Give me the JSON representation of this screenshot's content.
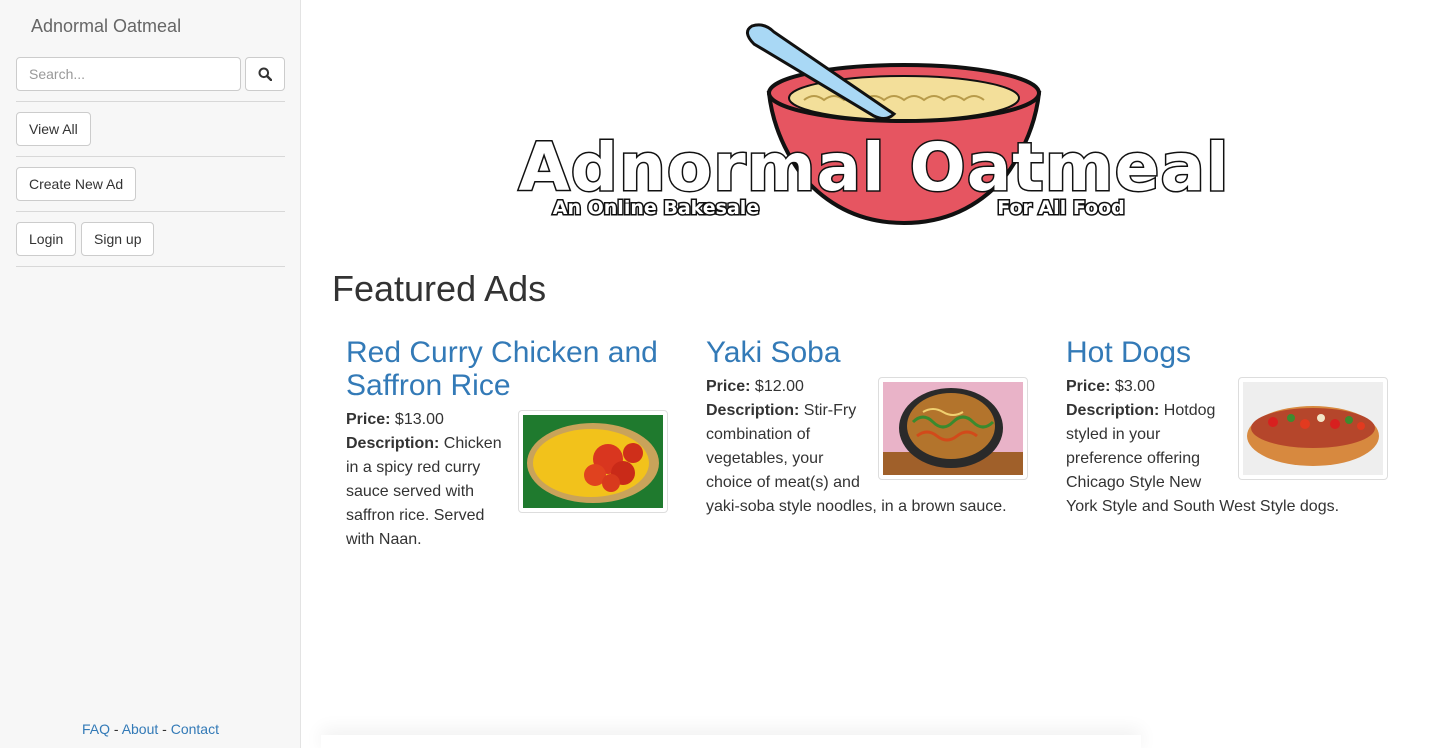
{
  "sidebar": {
    "brand": "Adnormal Oatmeal",
    "search_placeholder": "Search...",
    "view_all_label": "View All",
    "create_ad_label": "Create New Ad",
    "login_label": "Login",
    "signup_label": "Sign up",
    "footer": {
      "faq": "FAQ",
      "sep1": " - ",
      "about": "About",
      "sep2": " - ",
      "contact": "Contact"
    }
  },
  "logo": {
    "title": "Adnormal Oatmeal",
    "tagline_left": "An Online Bakesale",
    "tagline_right": "For All Food"
  },
  "main": {
    "featured_heading": "Featured Ads",
    "price_label": "Price:",
    "description_label": "Description:",
    "ads": [
      {
        "title": "Red Curry Chicken and Saffron Rice",
        "price": "$13.00",
        "description": "Chicken in a spicy red curry sauce served with saffron rice. Served with Naan.",
        "image_icon": "curry-plate-image"
      },
      {
        "title": "Yaki Soba",
        "price": "$12.00",
        "description": "Stir-Fry combination of vegetables, your choice of meat(s) and yaki-soba style noodles, in a brown sauce.",
        "image_icon": "noodle-bowl-image"
      },
      {
        "title": "Hot Dogs",
        "price": "$3.00",
        "description": "Hotdog styled in your preference offering Chicago Style New York Style and South West Style dogs.",
        "image_icon": "hotdog-image"
      }
    ]
  },
  "colors": {
    "link": "#337ab7",
    "sidebar_bg": "#f7f7f7",
    "bowl_red": "#e65561",
    "oatmeal": "#f3df9a",
    "spoon": "#a9d8f5"
  }
}
